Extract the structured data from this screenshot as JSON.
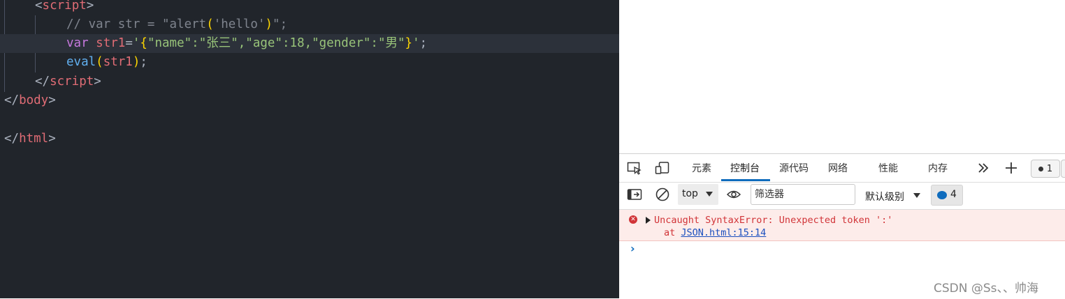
{
  "editor": {
    "lines": [
      {
        "indent": "    ",
        "open": "<",
        "tag": "script",
        "close": ">"
      },
      {
        "comment": "// var str = \"alert(",
        "comment_paren_open": "(",
        "comment_mid": "'hello'",
        "comment_paren_close": ")",
        "comment_end": "\";"
      },
      {
        "kw": "var",
        "name": "str1",
        "eq": "=",
        "q1": "'",
        "brace_open": "{",
        "json": "\"name\":\"张三\",\"age\":18,\"gender\":\"男\"",
        "brace_close": "}",
        "q2": "'",
        "semi": ";"
      },
      {
        "fn": "eval",
        "paren_open": "(",
        "arg": "str1",
        "paren_close": ")",
        "semi": ";"
      },
      {
        "open": "</",
        "tag": "script",
        "close": ">"
      },
      {
        "open": "</",
        "tag": "body",
        "close": ">"
      },
      {
        "open": "</",
        "tag": "html",
        "close": ">"
      }
    ]
  },
  "devtools": {
    "tabs": [
      "元素",
      "控制台",
      "源代码",
      "网络",
      "性能",
      "内存"
    ],
    "active_tab": "控制台",
    "error_count": "1",
    "context": "top",
    "filter_placeholder": "筛选器",
    "levels_label": "默认级别",
    "message_count": "4",
    "error_message": "Uncaught SyntaxError: Unexpected token ':'",
    "error_at": "at ",
    "error_location": "JSON.html:15:14",
    "prompt_symbol": "›"
  },
  "watermark": "CSDN @Ss、、帅海",
  "colors": {
    "editor_bg": "#21252b",
    "tag": "#e06c75",
    "string": "#98c379",
    "keyword": "#c678dd",
    "function": "#61afef",
    "comment": "#7f848e",
    "accent": "#0f6cbd",
    "error": "#d13438"
  },
  "icons": [
    "inspect-icon",
    "device-icon",
    "more-tabs-icon",
    "plus-icon",
    "sidebar-icon",
    "clear-icon",
    "eye-icon",
    "message-icon",
    "error-icon"
  ]
}
